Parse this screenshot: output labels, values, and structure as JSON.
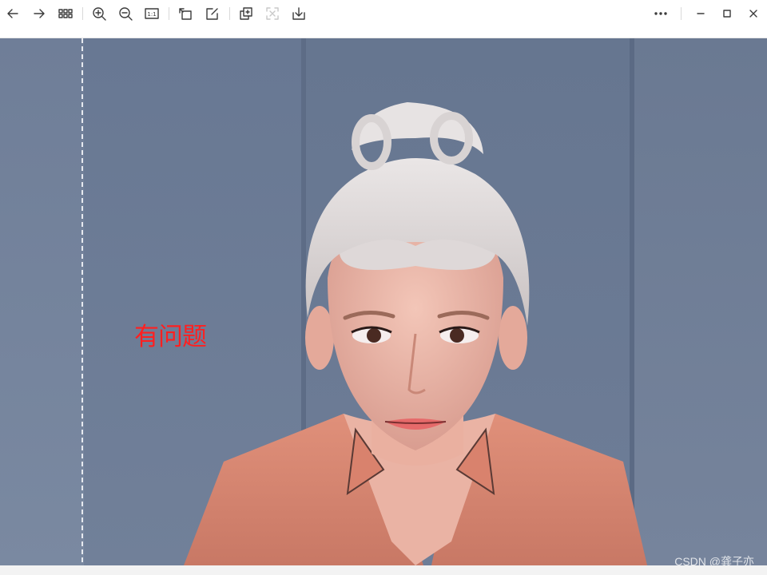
{
  "toolbar": {
    "items": [
      {
        "name": "back-icon",
        "enabled": true
      },
      {
        "name": "forward-icon",
        "enabled": true
      },
      {
        "name": "grid-view-icon",
        "enabled": true
      },
      {
        "name": "zoom-in-icon",
        "enabled": true
      },
      {
        "name": "zoom-out-icon",
        "enabled": true
      },
      {
        "name": "actual-size-icon",
        "enabled": true
      },
      {
        "name": "rotate-icon",
        "enabled": true
      },
      {
        "name": "edit-icon",
        "enabled": true
      },
      {
        "name": "copy-icon",
        "enabled": true
      },
      {
        "name": "extract-text-icon",
        "enabled": false
      },
      {
        "name": "download-icon",
        "enabled": true
      },
      {
        "name": "more-icon",
        "enabled": true
      }
    ],
    "actual_size_label": "1:1",
    "window_controls": [
      "minimize-icon",
      "maximize-icon",
      "close-icon"
    ]
  },
  "image": {
    "annotation_text": "有问题",
    "annotation_color": "#ff2020",
    "watermark": "CSDN @龚子亦",
    "background_color": "#6c7b96"
  }
}
